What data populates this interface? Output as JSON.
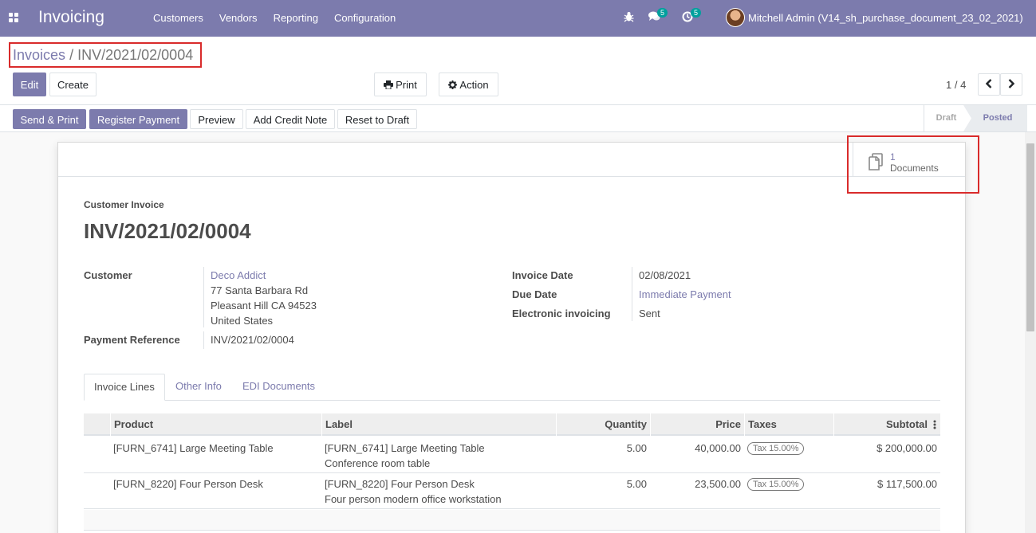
{
  "navbar": {
    "app_title": "Invoicing",
    "menu": [
      "Customers",
      "Vendors",
      "Reporting",
      "Configuration"
    ],
    "chat_badge": "5",
    "activity_badge": "5",
    "user": "Mitchell Admin (V14_sh_purchase_document_23_02_2021)"
  },
  "breadcrumb": {
    "parent": "Invoices",
    "separator": "/",
    "current": "INV/2021/02/0004"
  },
  "control": {
    "edit": "Edit",
    "create": "Create",
    "print": "Print",
    "action": "Action",
    "pager": "1 / 4"
  },
  "statusbar": {
    "buttons": [
      "Send & Print",
      "Register Payment",
      "Preview",
      "Add Credit Note",
      "Reset to Draft"
    ],
    "stages": [
      "Draft",
      "Posted"
    ]
  },
  "smart_button": {
    "count": "1",
    "label": "Documents"
  },
  "invoice": {
    "type": "Customer Invoice",
    "name": "INV/2021/02/0004",
    "customer_label": "Customer",
    "customer_name": "Deco Addict",
    "address": [
      "77 Santa Barbara Rd",
      "Pleasant Hill CA 94523",
      "United States"
    ],
    "payment_ref_label": "Payment Reference",
    "payment_ref": "INV/2021/02/0004",
    "invoice_date_label": "Invoice Date",
    "invoice_date": "02/08/2021",
    "due_date_label": "Due Date",
    "due_date": "Immediate Payment",
    "edi_label": "Electronic invoicing",
    "edi": "Sent"
  },
  "tabs": [
    "Invoice Lines",
    "Other Info",
    "EDI Documents"
  ],
  "table": {
    "headers": [
      "Product",
      "Label",
      "Quantity",
      "Price",
      "Taxes",
      "Subtotal"
    ],
    "rows": [
      {
        "product": "[FURN_6741] Large Meeting Table",
        "label1": "[FURN_6741] Large Meeting Table",
        "label2": "Conference room table",
        "qty": "5.00",
        "price": "40,000.00",
        "tax": "Tax 15.00%",
        "subtotal": "$ 200,000.00"
      },
      {
        "product": "[FURN_8220] Four Person Desk",
        "label1": "[FURN_8220] Four Person Desk",
        "label2": "Four person modern office workstation",
        "qty": "5.00",
        "price": "23,500.00",
        "tax": "Tax 15.00%",
        "subtotal": "$ 117,500.00"
      }
    ]
  }
}
